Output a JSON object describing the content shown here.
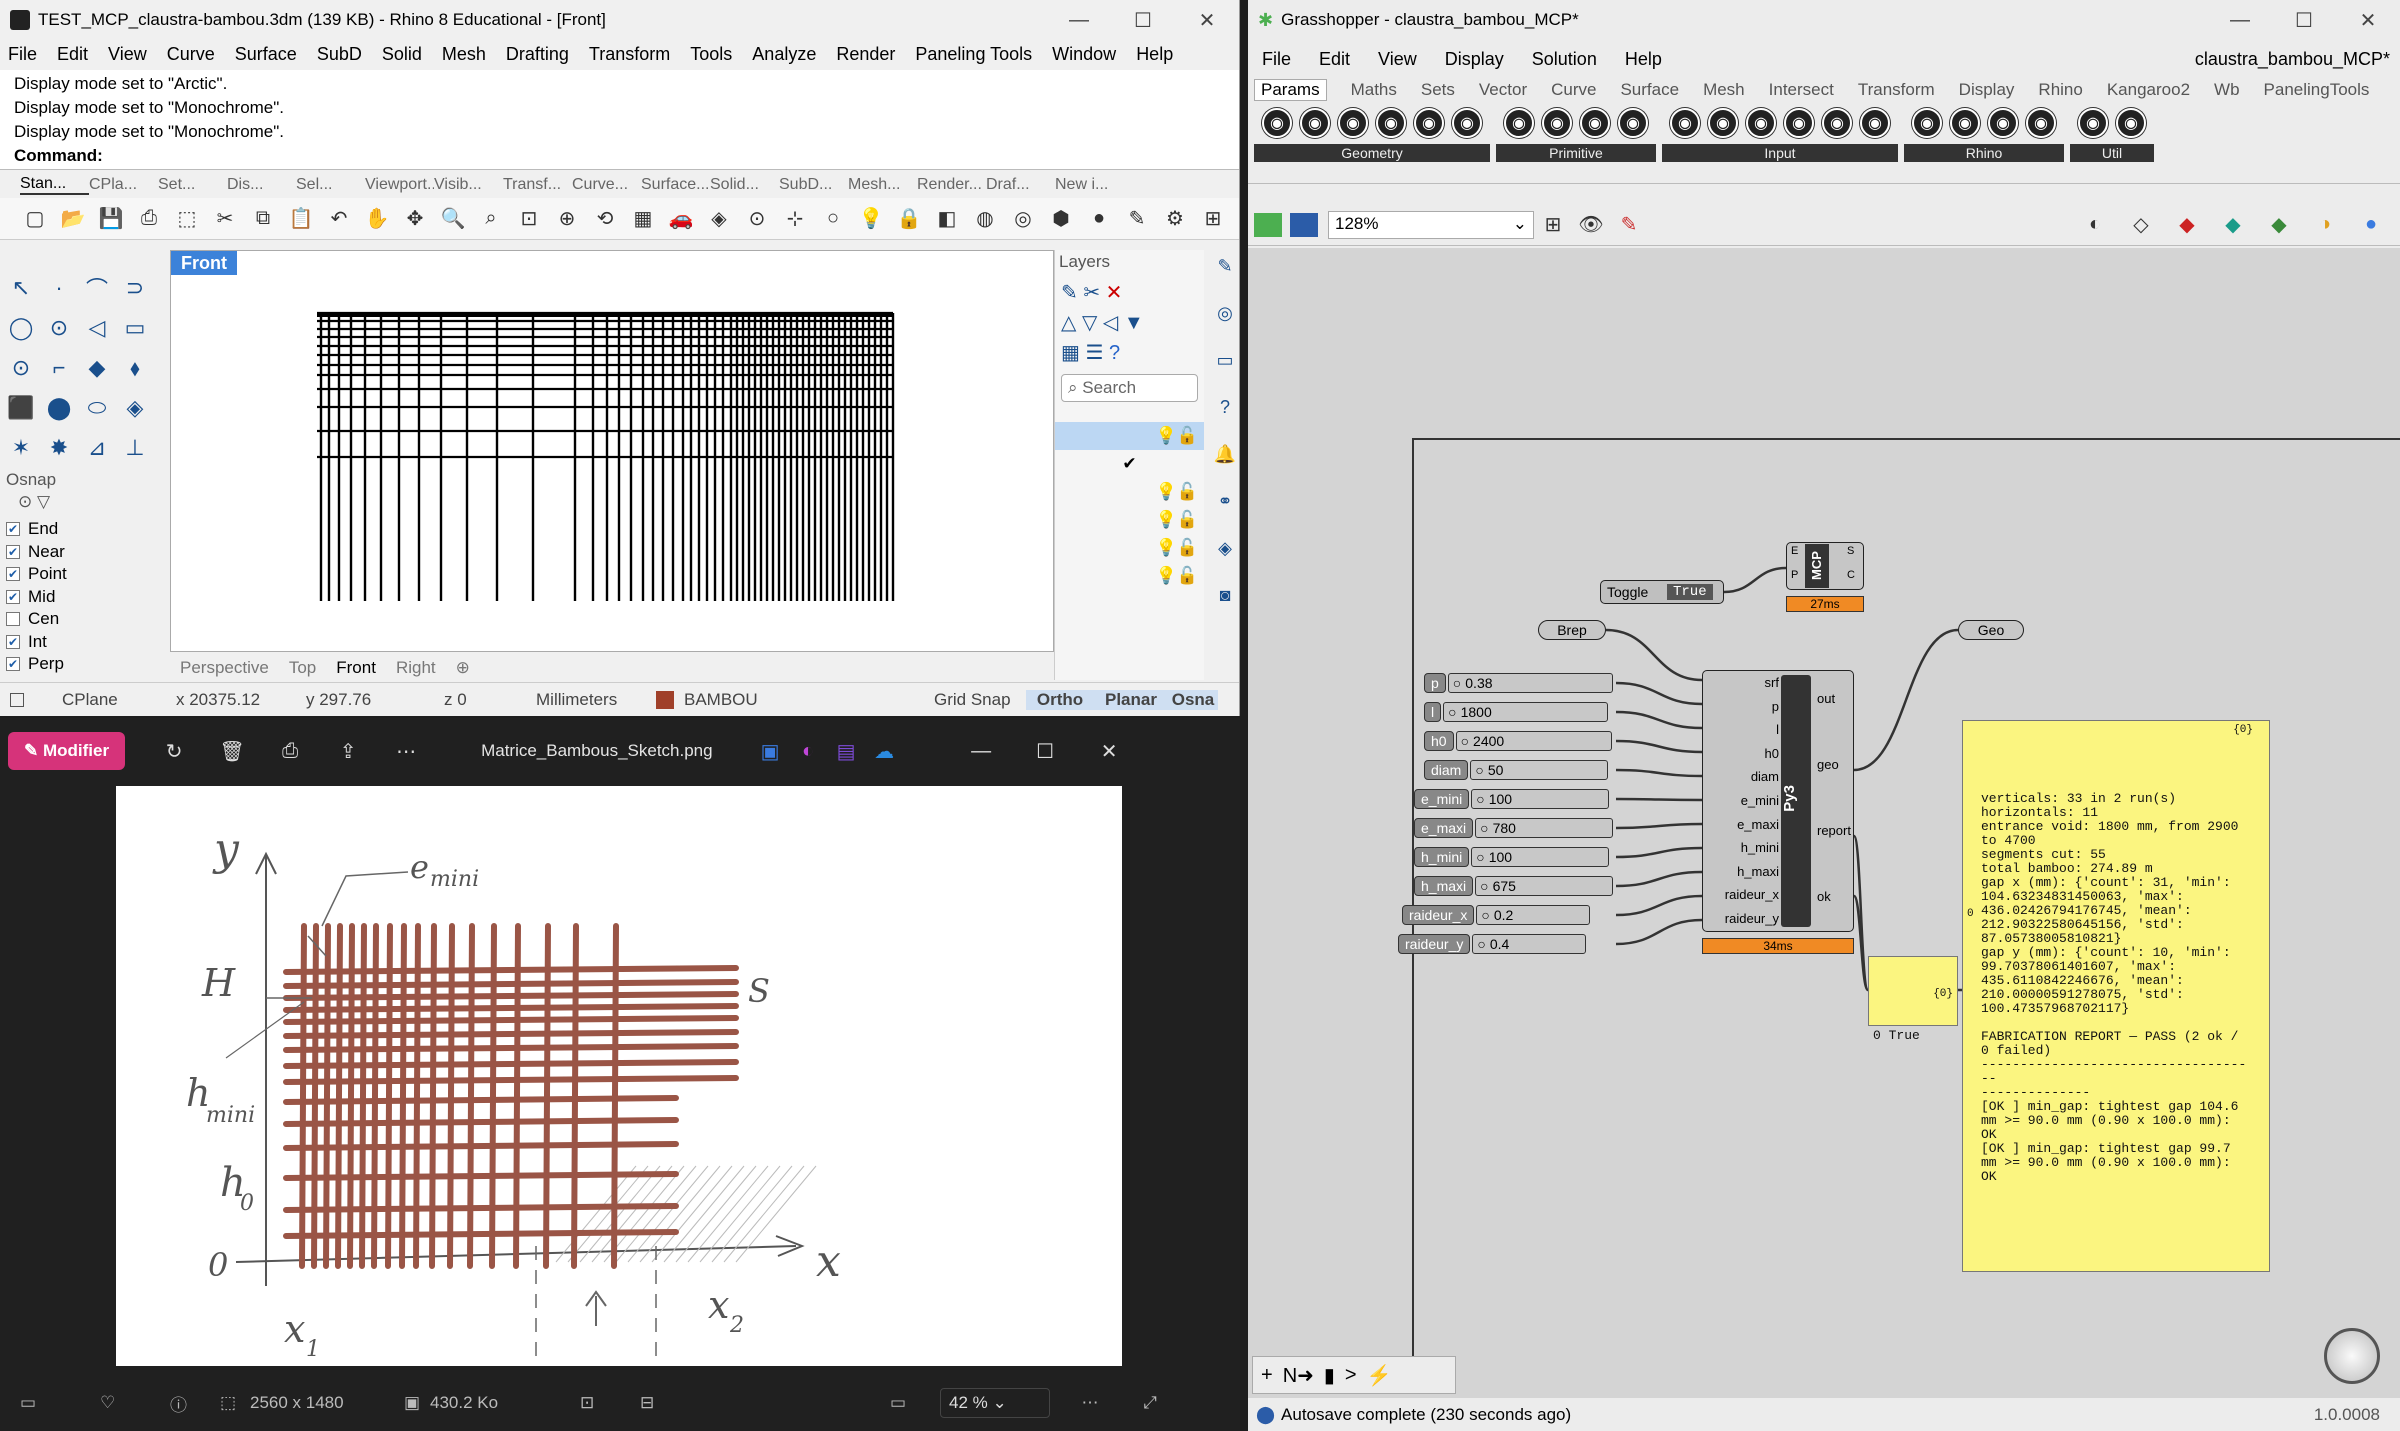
{
  "rhino": {
    "title": "TEST_MCP_claustra-bambou.3dm (139 KB) - Rhino 8 Educational - [Front]",
    "menu": [
      "File",
      "Edit",
      "View",
      "Curve",
      "Surface",
      "SubD",
      "Solid",
      "Mesh",
      "Drafting",
      "Transform",
      "Tools",
      "Analyze",
      "Render",
      "Paneling Tools",
      "Window",
      "Help"
    ],
    "history": [
      "Display mode set to \"Arctic\".",
      "Display mode set to \"Monochrome\".",
      "Display mode set to \"Monochrome\"."
    ],
    "command_label": "Command:",
    "tabs": [
      "Stan...",
      "CPla...",
      "Set...",
      "Dis...",
      "Sel...",
      "Viewport...",
      "Visib...",
      "Transf...",
      "Curve...",
      "Surface...",
      "Solid...",
      "SubD...",
      "Mesh...",
      "Render...",
      "Draf...",
      "New i..."
    ],
    "viewport_name": "Front",
    "view_tabs": [
      "Perspective",
      "Top",
      "Front",
      "Right"
    ],
    "osnap": {
      "title": "Osnap",
      "items": [
        {
          "label": "End",
          "checked": true
        },
        {
          "label": "Near",
          "checked": true
        },
        {
          "label": "Point",
          "checked": true
        },
        {
          "label": "Mid",
          "checked": true
        },
        {
          "label": "Cen",
          "checked": false
        },
        {
          "label": "Int",
          "checked": true
        },
        {
          "label": "Perp",
          "checked": true
        }
      ]
    },
    "layers": {
      "title": "Layers",
      "search": "Search"
    },
    "status": {
      "cplane": "CPlane",
      "x": "x 20375.12",
      "y": "y 297.76",
      "z": "z 0",
      "units": "Millimeters",
      "layer": "BAMBOU",
      "grid": "Grid Snap",
      "ortho": "Ortho",
      "planar": "Planar",
      "osnap": "Osna"
    }
  },
  "photos": {
    "modify": "Modifier",
    "filename": "Matrice_Bambous_Sketch.png",
    "dims": "2560 x 1480",
    "size": "430.2 Ko",
    "zoom": "42 %",
    "sketch_labels": {
      "y": "y",
      "x": "x",
      "emini": "e",
      "emini_sub": "mini",
      "H": "H",
      "hmini": "h",
      "hmini_sub": "mini",
      "h0": "h",
      "h0_sub": "0",
      "zero": "0",
      "S": "S",
      "x1": "x",
      "x1_sub": "1",
      "x2": "x",
      "x2_sub": "2"
    }
  },
  "gh": {
    "title": "Grasshopper - claustra_bambou_MCP*",
    "menu": [
      "File",
      "Edit",
      "View",
      "Display",
      "Solution",
      "Help"
    ],
    "doc": "claustra_bambou_MCP*",
    "tabs": [
      "Params",
      "Maths",
      "Sets",
      "Vector",
      "Curve",
      "Surface",
      "Mesh",
      "Intersect",
      "Transform",
      "Display",
      "Rhino",
      "Kangaroo2",
      "Wb",
      "PanelingTools"
    ],
    "groups": [
      "Geometry",
      "Primitive",
      "Input",
      "Rhino",
      "Util"
    ],
    "zoom": "128%",
    "toggle": {
      "label": "Toggle",
      "value": "True"
    },
    "mcp": {
      "name": "MCP",
      "inputs": [
        "E",
        "P"
      ],
      "outputs": [
        "S",
        "C"
      ],
      "time": "27ms"
    },
    "brep": "Brep",
    "geo": "Geo",
    "py": {
      "name": "Py3",
      "inputs": [
        "srf",
        "p",
        "l",
        "h0",
        "diam",
        "e_mini",
        "e_maxi",
        "h_mini",
        "h_maxi",
        "raideur_x",
        "raideur_y"
      ],
      "outputs": [
        "out",
        "geo",
        "report",
        "ok"
      ],
      "time": "34ms"
    },
    "sliders": [
      {
        "name": "p",
        "value": "0.38"
      },
      {
        "name": "l",
        "value": "1800"
      },
      {
        "name": "h0",
        "value": "2400"
      },
      {
        "name": "diam",
        "value": "50"
      },
      {
        "name": "e_mini",
        "value": "100"
      },
      {
        "name": "e_maxi",
        "value": "780"
      },
      {
        "name": "h_mini",
        "value": "100"
      },
      {
        "name": "h_maxi",
        "value": "675"
      },
      {
        "name": "raideur_x",
        "value": "0.2"
      },
      {
        "name": "raideur_y",
        "value": "0.4"
      }
    ],
    "ok_panel": {
      "path": "{0}",
      "index": "0",
      "value": "True"
    },
    "report_panel": {
      "path": "{0}",
      "index": "0",
      "text": "verticals: 33 in 2 run(s)\nhorizontals: 11\nentrance void: 1800 mm, from 2900\nto 4700\nsegments cut: 55\ntotal bamboo: 274.89 m\ngap x (mm): {'count': 31, 'min':\n104.63234831450063, 'max':\n436.02426794176745, 'mean':\n212.90322580645156, 'std':\n87.05738005810821}\ngap y (mm): {'count': 10, 'min':\n99.70378061401607, 'max':\n435.6110842246676, 'mean':\n210.00000591278075, 'std':\n100.47357968702117}\n\nFABRICATION REPORT — PASS (2 ok /\n0 failed)\n------------------------------------\n--------------\n[OK ] min_gap: tightest gap 104.6\nmm >= 90.0 mm (0.90 x 100.0 mm):\nOK\n[OK ] min_gap: tightest gap 99.7\nmm >= 90.0 mm (0.90 x 100.0 mm):\nOK"
    },
    "status": "Autosave complete (230 seconds ago)",
    "version": "1.0.0008"
  }
}
